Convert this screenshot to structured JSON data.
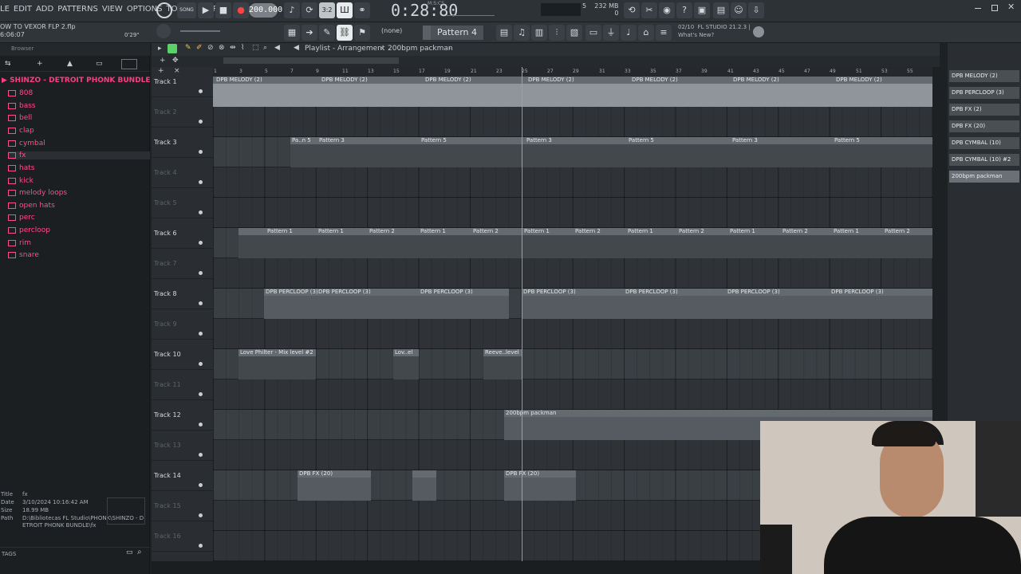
{
  "menu": [
    "LE",
    "EDIT",
    "ADD",
    "PATTERNS",
    "VIEW",
    "OPTIONS",
    "TOOLS",
    "HELP"
  ],
  "transport": {
    "mode": "SONG",
    "tempo": "200.000",
    "time": "0:28:80",
    "time_unit": "M:S:CS"
  },
  "system": {
    "memory": "232 MB",
    "cpu_val": "5",
    "cpu_zero": "0"
  },
  "project": {
    "title": "OW TO VEXOR FLP 2.flp",
    "time": "6:06:07",
    "pos": "0'29\""
  },
  "toolbar2": {
    "channel": "(none)",
    "pattern": "Pattern 4"
  },
  "news": {
    "date": "02/10",
    "version": "FL STUDIO 21.2.3 |",
    "whats_new": "What's New?"
  },
  "browser": {
    "title": "Browser",
    "bundle": "SHINZO - DETROIT PHONK BUNDLE",
    "folders": [
      "808",
      "bass",
      "bell",
      "clap",
      "cymbal",
      "fx",
      "hats",
      "kick",
      "melody loops",
      "open hats",
      "perc",
      "percloop",
      "rim",
      "snare"
    ],
    "fileinfo": {
      "title_k": "Title",
      "title_v": "fx",
      "date_k": "Date",
      "date_v": "3/10/2024 10:16:42 AM",
      "size_k": "Size",
      "size_v": "18.99 MB",
      "path_k": "Path",
      "path_v": "D:\\Bibliotecas FL Studio\\PHONK\\SHINZO - DETROIT PHONK BUNDLE\\fx"
    },
    "tags": "TAGS"
  },
  "playlist": {
    "breadcrumb": "Playlist - Arrangement",
    "arrow": "›",
    "current": "200bpm packman",
    "tracks": [
      "Track 1",
      "Track 2",
      "Track 3",
      "Track 4",
      "Track 5",
      "Track 6",
      "Track 7",
      "Track 8",
      "Track 9",
      "Track 10",
      "Track 11",
      "Track 12",
      "Track 13",
      "Track 14",
      "Track 15",
      "Track 16"
    ],
    "bars": [
      "1",
      "3",
      "5",
      "7",
      "9",
      "11",
      "13",
      "15",
      "17",
      "19",
      "21",
      "23",
      "25",
      "27",
      "29",
      "31",
      "33",
      "35",
      "37",
      "39",
      "41",
      "43",
      "45",
      "47",
      "49",
      "51",
      "53",
      "55"
    ],
    "clips": {
      "melody": "DPB MELODY (2)",
      "pattern3": "Pattern 3",
      "pattern5": "Pattern 5",
      "pattern_short": "Pa..n 5",
      "pattern1": "Pattern 1",
      "pattern2": "Pattern 2",
      "percloop": "DPB PERCLOOP (3)",
      "love": "Love Philter - Mix level #2",
      "lov": "Lov..el",
      "reeve": "Reeve..level",
      "packman": "200bpm packman",
      "fx": "DPB FX (20)"
    }
  },
  "picker": [
    "DPB MELODY (2)",
    "DPB PERCLOOP (3)",
    "DPB FX (2)",
    "DPB FX (20)",
    "DPB CYMBAL (10)",
    "DPB CYMBAL (10) #2",
    "200bpm packman"
  ]
}
